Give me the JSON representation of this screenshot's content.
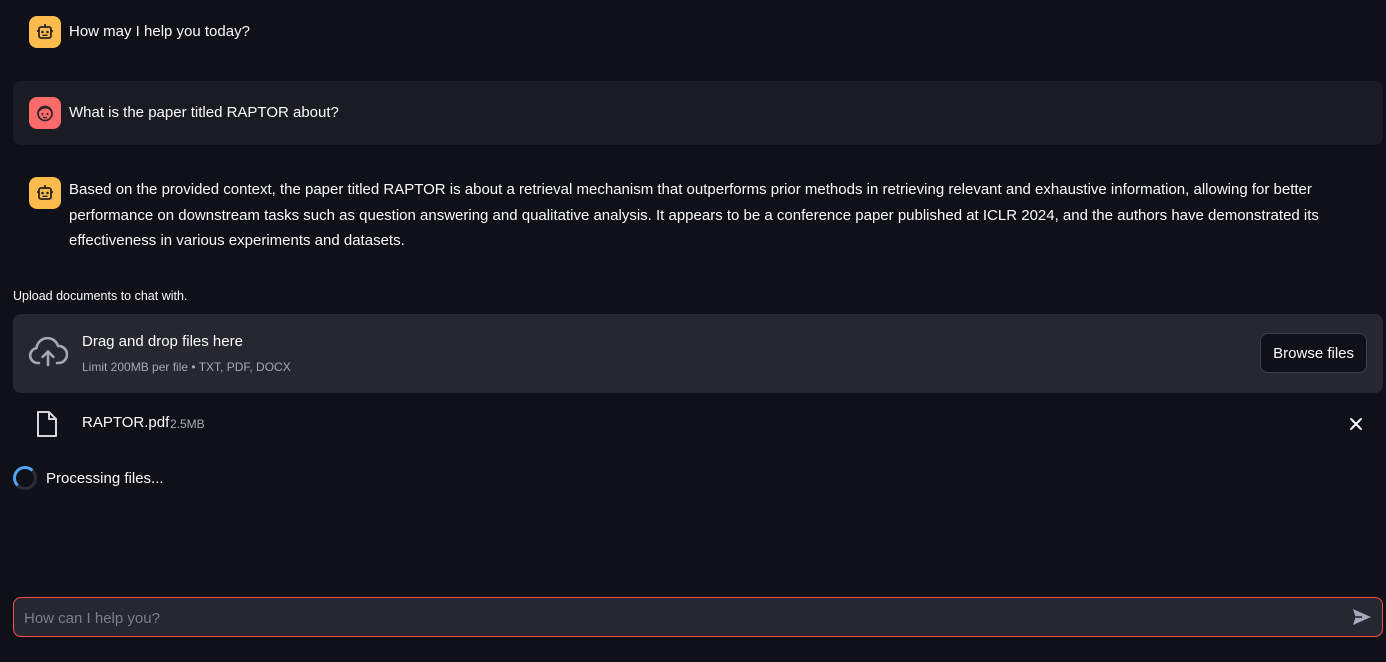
{
  "messages": [
    {
      "role": "assistant",
      "avatar_icon": "robot-icon",
      "text": "How may I help you today?"
    },
    {
      "role": "user",
      "avatar_icon": "face-icon",
      "text": "What is the paper titled RAPTOR about?"
    },
    {
      "role": "assistant",
      "avatar_icon": "robot-icon",
      "text": "Based on the provided context, the paper titled RAPTOR is about a retrieval mechanism that outperforms prior methods in retrieving relevant and exhaustive information, allowing for better performance on downstream tasks such as question answering and qualitative analysis. It appears to be a conference paper published at ICLR 2024, and the authors have demonstrated its effectiveness in various experiments and datasets."
    }
  ],
  "uploader": {
    "label": "Upload documents to chat with.",
    "drop_title": "Drag and drop files here",
    "drop_subtitle": "Limit 200MB per file • TXT, PDF, DOCX",
    "browse_label": "Browse files",
    "icon": "cloud-upload-icon"
  },
  "uploaded_file": {
    "name": "RAPTOR.pdf",
    "size": "2.5MB",
    "icon": "file-icon",
    "remove_icon": "close-icon"
  },
  "status": {
    "text": "Processing files...",
    "icon": "spinner-icon"
  },
  "chat_input": {
    "placeholder": "How can I help you?",
    "value": "",
    "send_icon": "send-icon"
  },
  "colors": {
    "background": "#0e1117",
    "user_message_bg": "#1a1c24",
    "assistant_avatar": "#fdba4d",
    "user_avatar": "#ff6b6b",
    "input_border_focus": "#ff4b4b",
    "spinner_accent": "#4fa3f7"
  }
}
